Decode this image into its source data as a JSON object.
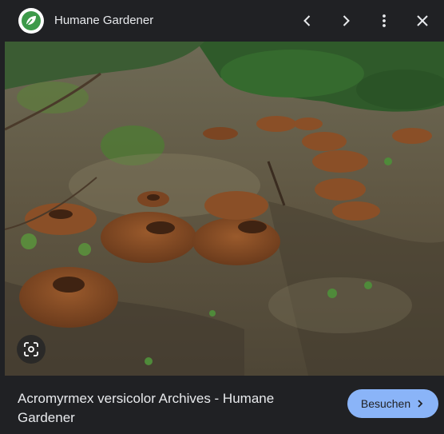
{
  "header": {
    "site_name": "Humane Gardener",
    "logo_icon": "leaf-logo-icon",
    "prev_icon": "chevron-left-icon",
    "next_icon": "chevron-right-icon",
    "more_icon": "more-vert-icon",
    "close_icon": "close-icon"
  },
  "image": {
    "lens_icon": "google-lens-icon"
  },
  "footer": {
    "title": "Acromyrmex versicolor Archives - Humane Gardener",
    "visit_label": "Besuchen",
    "visit_icon": "chevron-right-icon"
  },
  "colors": {
    "background": "#202124",
    "text": "#e8eaed",
    "accent": "#8ab4f8",
    "logo_green": "#3d9a4a"
  }
}
